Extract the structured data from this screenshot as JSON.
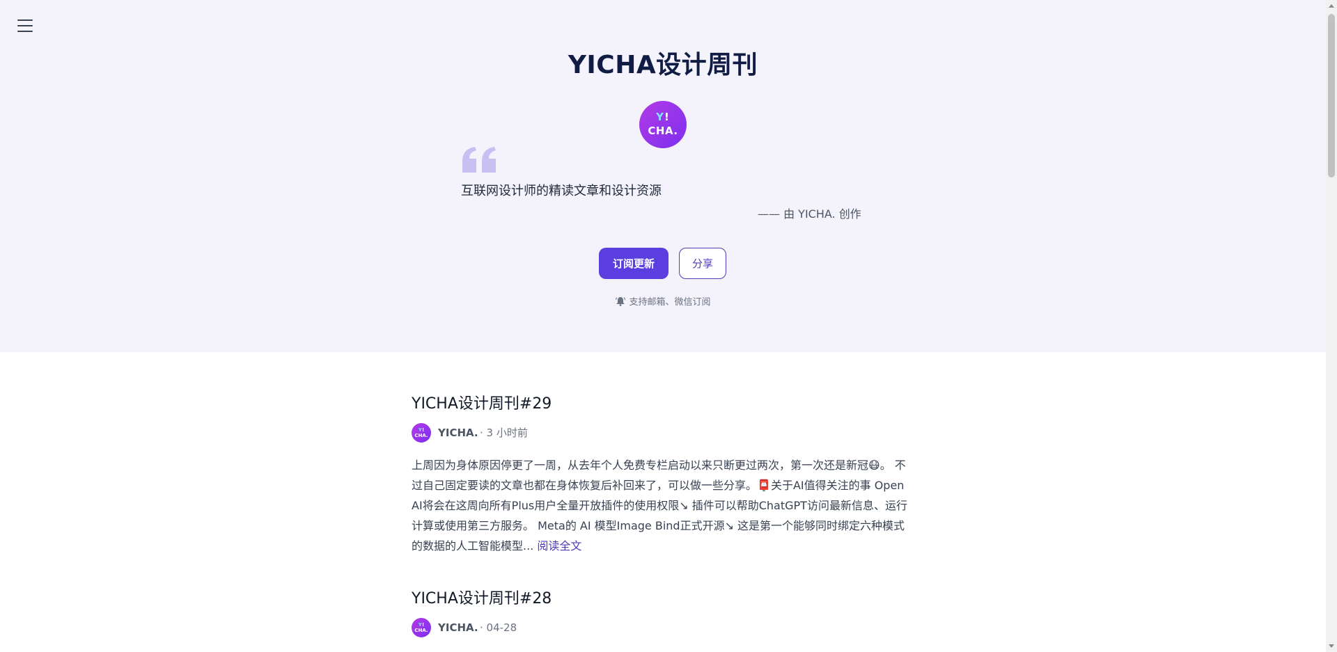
{
  "header": {
    "menu_icon": "hamburger-menu-icon",
    "site_title": "YICHA设计周刊",
    "logo": {
      "line1_y": "Y",
      "line1_rest": "!",
      "line2": "CHA."
    },
    "quote_icon": "quote-icon",
    "tagline": "互联网设计师的精读文章和设计资源",
    "byline": "—— 由 YICHA. 创作",
    "subscribe_label": "订阅更新",
    "share_label": "分享",
    "support_icon": "bell-icon",
    "support_note": "支持邮箱、微信订阅",
    "accent_color": "#5b3ee0",
    "hero_bg": "#f4f3fb"
  },
  "articles": [
    {
      "title": "YICHA设计周刊#29",
      "avatar": {
        "line1_y": "Y",
        "line1_rest": "!",
        "line2": "CHA."
      },
      "author": "YICHA.",
      "time": "· 3 小时前",
      "excerpt_part1": "上周因为身体原因停更了一周，从去年个人免费专栏启动以来只断更过两次，第一次还是新冠",
      "emoji1": "😷",
      "excerpt_part2": "。 不过自己固定要读的文章也都在身体恢复后补回来了，可以做一些分享。",
      "emoji2": "📮",
      "excerpt_part3": "关于AI值得关注的事 Open AI将会在这周向所有Plus用户全量开放插件的使用权限↘ 插件可以帮助ChatGPT访问最新信息、运行计算或使用第三方服务。 Meta的 AI 模型Image Bind正式开源↘ 这是第一个能够同时绑定六种模式的数据的人工智能模型...",
      "read_more": "阅读全文"
    },
    {
      "title": "YICHA设计周刊#28",
      "avatar": {
        "line1_y": "Y",
        "line1_rest": "!",
        "line2": "CHA."
      },
      "author": "YICHA.",
      "time": "· 04-28",
      "excerpt_part1": "",
      "emoji1": "",
      "excerpt_part2": "",
      "emoji2": "",
      "excerpt_part3": "",
      "read_more": ""
    }
  ]
}
